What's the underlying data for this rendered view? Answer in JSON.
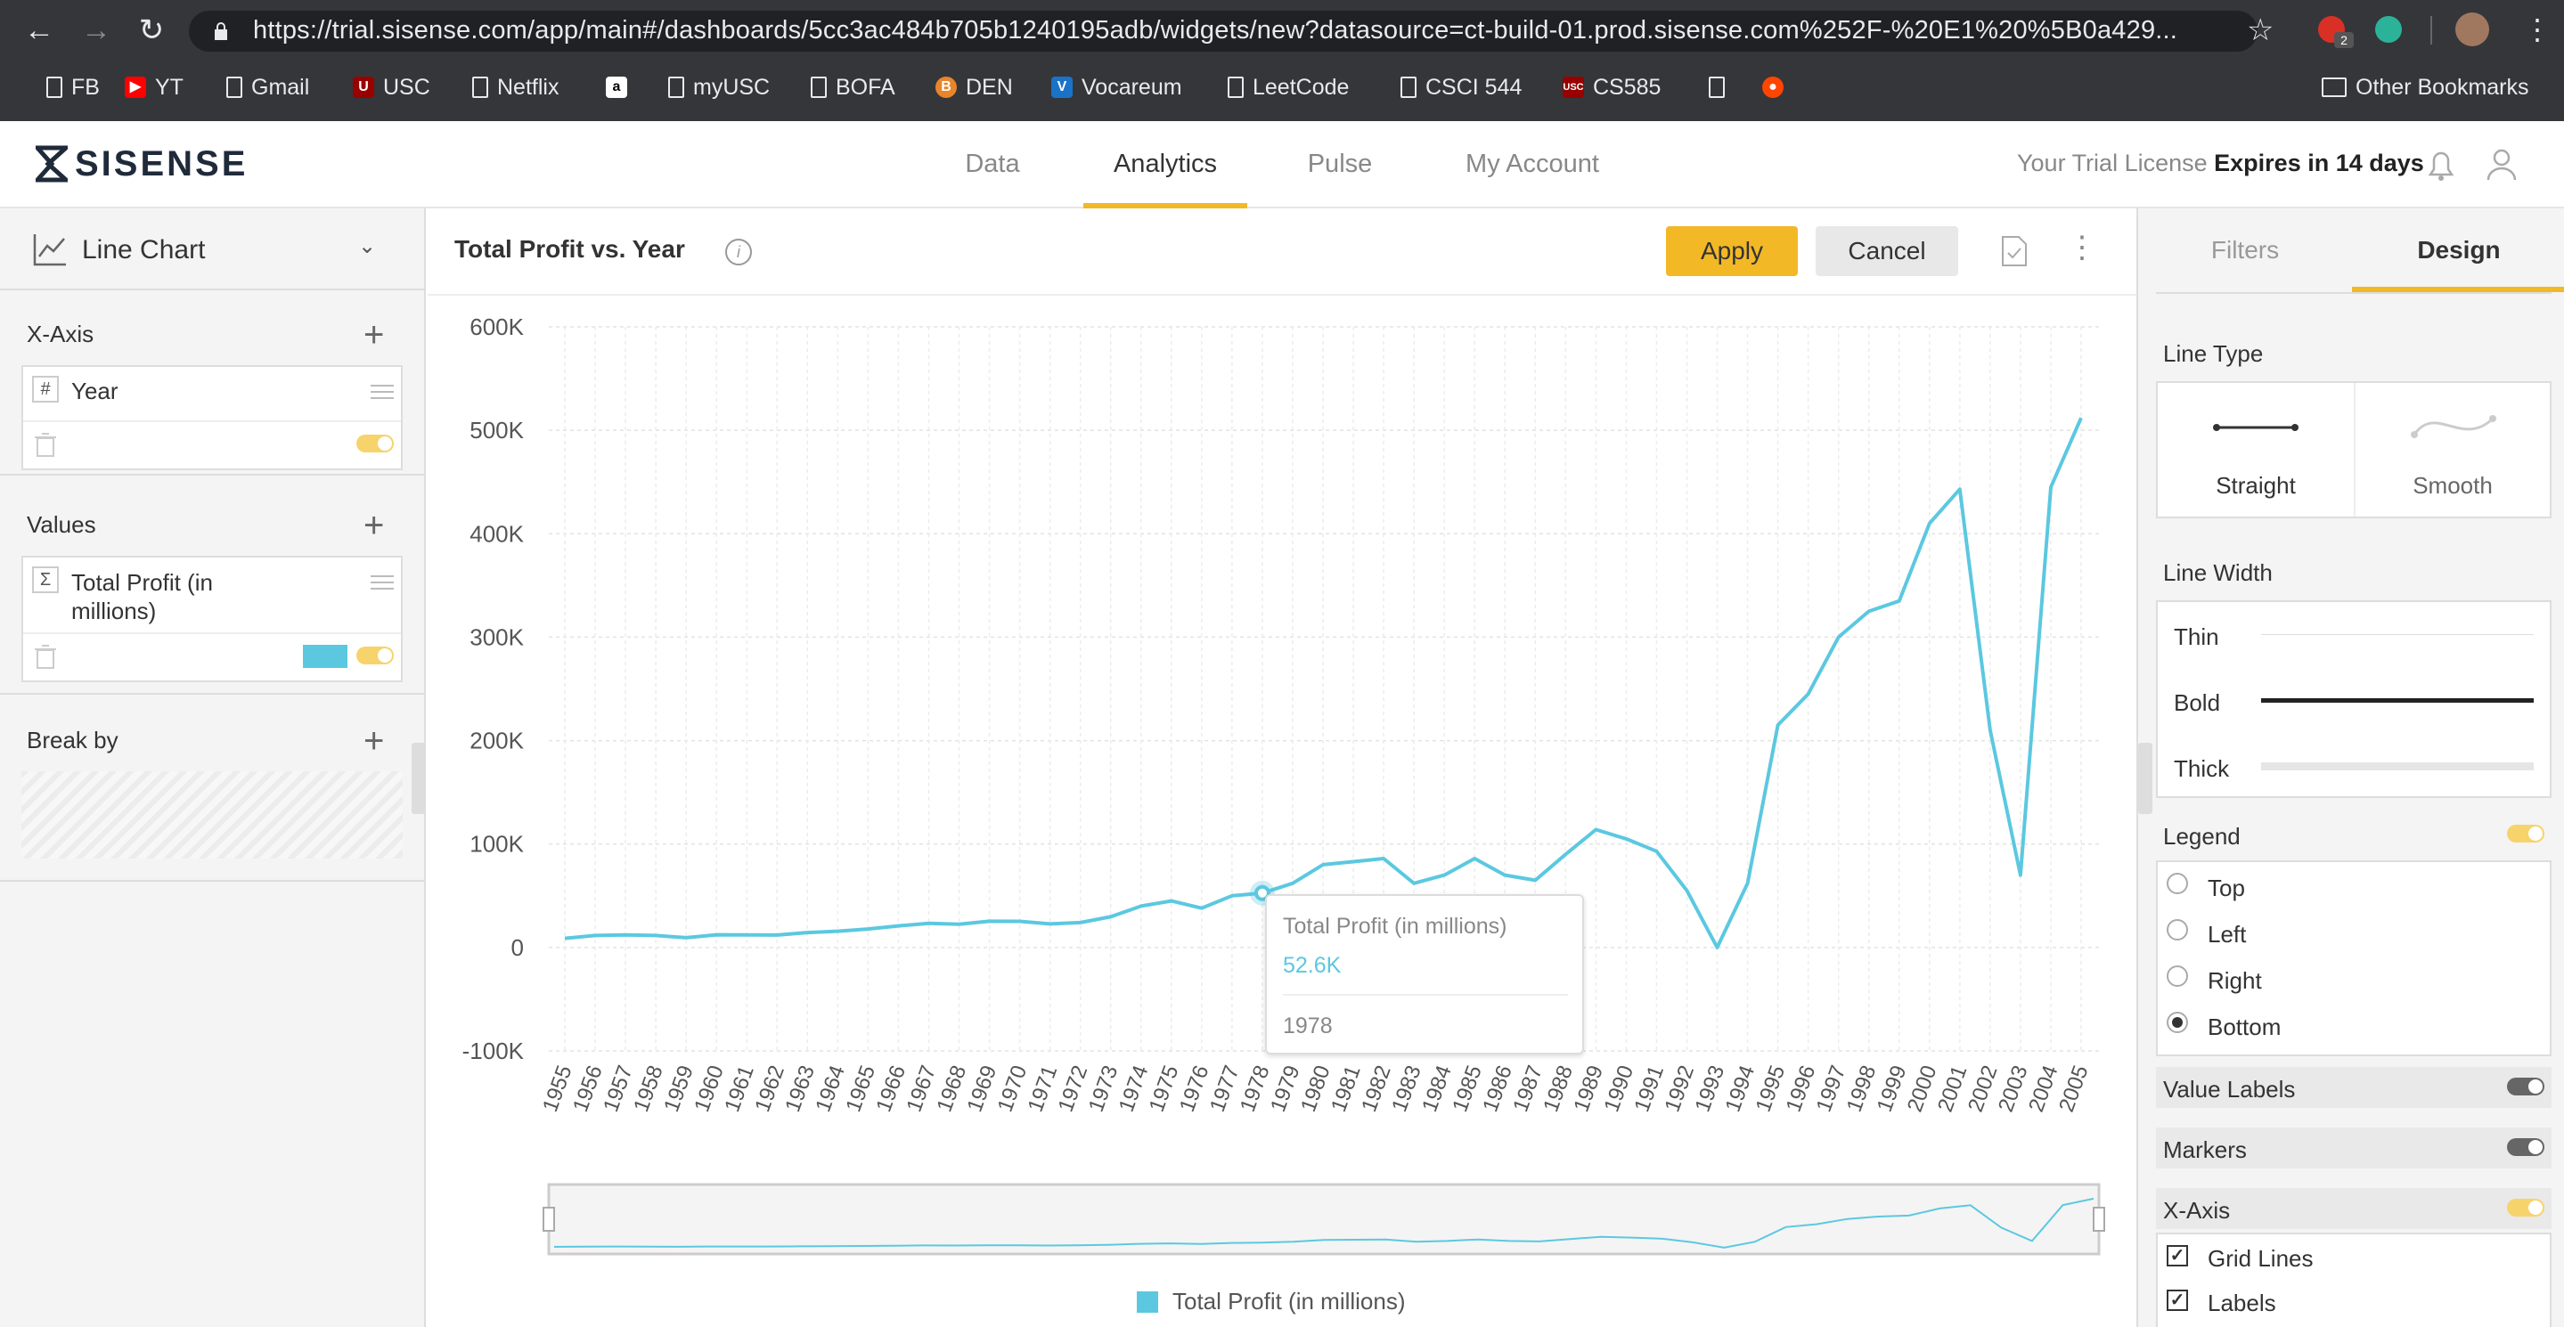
{
  "browser": {
    "url": "https://trial.sisense.com/app/main#/dashboards/5cc3ac484b705b1240195adb/widgets/new?datasource=ct-build-01.prod.sisense.com%252F-%20E1%20%5B0a429...",
    "bookmarks": [
      "FB",
      "YT",
      "Gmail",
      "USC",
      "Netflix",
      "a",
      "myUSC",
      "BOFA",
      "DEN",
      "Vocareum",
      "LeetCode",
      "CSCI 544",
      "CS585"
    ],
    "other_bookmarks": "Other Bookmarks",
    "ext_badge": "2"
  },
  "app": {
    "logo": "SISENSE",
    "nav": [
      "Data",
      "Analytics",
      "Pulse",
      "My Account"
    ],
    "active_nav": "Analytics",
    "license_prefix": "Your Trial License",
    "license_expiry": "Expires in 14 days"
  },
  "left_panel": {
    "chart_type": "Line Chart",
    "xaxis_title": "X-Axis",
    "xaxis_field": "Year",
    "xaxis_field_icon": "#",
    "values_title": "Values",
    "values_field": "Total Profit (in millions)",
    "values_field_icon": "Σ",
    "values_color": "#5bc8e0",
    "breakby_title": "Break by"
  },
  "widget": {
    "title": "Total Profit vs. Year",
    "apply_label": "Apply",
    "cancel_label": "Cancel",
    "legend_label": "Total Profit (in millions)",
    "tooltip": {
      "series": "Total Profit (in millions)",
      "value": "52.6K",
      "category": "1978"
    }
  },
  "chart_data": {
    "type": "line",
    "title": "Total Profit vs. Year",
    "xlabel": "",
    "ylabel": "",
    "ylim": [
      -100000,
      600000
    ],
    "yticks": [
      -100000,
      0,
      100000,
      200000,
      300000,
      400000,
      500000,
      600000
    ],
    "ytick_labels": [
      "-100K",
      "0",
      "100K",
      "200K",
      "300K",
      "400K",
      "500K",
      "600K"
    ],
    "grid": true,
    "legend_position": "bottom",
    "categories": [
      "1955",
      "1956",
      "1957",
      "1958",
      "1959",
      "1960",
      "1961",
      "1962",
      "1963",
      "1964",
      "1965",
      "1966",
      "1967",
      "1968",
      "1969",
      "1970",
      "1971",
      "1972",
      "1973",
      "1974",
      "1975",
      "1976",
      "1977",
      "1978",
      "1979",
      "1980",
      "1981",
      "1982",
      "1983",
      "1984",
      "1985",
      "1986",
      "1987",
      "1988",
      "1989",
      "1990",
      "1991",
      "1992",
      "1993",
      "1994",
      "1995",
      "1996",
      "1997",
      "1998",
      "1999",
      "2000",
      "2001",
      "2002",
      "2003",
      "2004",
      "2005"
    ],
    "series": [
      {
        "name": "Total Profit (in millions)",
        "color": "#5bc8e0",
        "values": [
          8800,
          11600,
          12200,
          11600,
          9400,
          12300,
          12200,
          12000,
          14400,
          15700,
          17900,
          20900,
          23300,
          22500,
          25400,
          25300,
          22800,
          24100,
          29700,
          40000,
          45000,
          38000,
          50000,
          52600,
          62000,
          80000,
          83000,
          86000,
          62000,
          70000,
          86000,
          70000,
          65000,
          90000,
          114000,
          105000,
          93000,
          55000,
          0,
          62000,
          215000,
          245000,
          300000,
          325000,
          335000,
          410000,
          443000,
          210000,
          70000,
          445000,
          512000
        ]
      }
    ]
  },
  "right_panel": {
    "tabs": [
      "Filters",
      "Design"
    ],
    "active_tab": "Design",
    "line_type_title": "Line Type",
    "line_type_options": [
      "Straight",
      "Smooth"
    ],
    "line_width_title": "Line Width",
    "line_width_options": [
      "Thin",
      "Bold",
      "Thick"
    ],
    "legend_title": "Legend",
    "legend_options": [
      "Top",
      "Left",
      "Right",
      "Bottom"
    ],
    "legend_selected": "Bottom",
    "value_labels_title": "Value Labels",
    "markers_title": "Markers",
    "xaxis_title": "X-Axis",
    "xaxis_options": [
      "Grid Lines",
      "Labels"
    ]
  }
}
